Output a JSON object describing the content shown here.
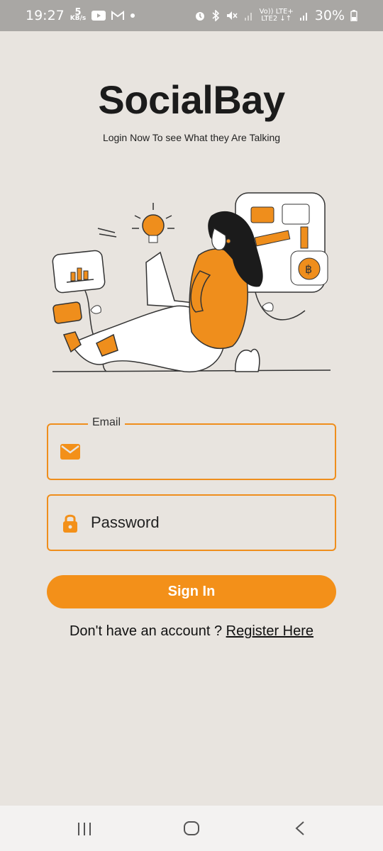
{
  "status_bar": {
    "time": "19:27",
    "speed_value": "5",
    "speed_unit": "KB/s",
    "lte_top": "Vo)) LTE+",
    "lte_bottom": "LTE2 ↓↑",
    "battery": "30%",
    "icons": [
      "youtube-icon",
      "gmail-icon",
      "dot-icon",
      "alarm-icon",
      "bluetooth-icon",
      "mute-icon",
      "signal-icon",
      "signal-icon",
      "battery-icon"
    ]
  },
  "app": {
    "title": "SocialBay",
    "subtitle": "Login Now To see What they Are Talking",
    "accent_color": "#f39019"
  },
  "form": {
    "email": {
      "label": "Email",
      "value": "",
      "placeholder": "",
      "icon": "mail-icon"
    },
    "password": {
      "label": "",
      "value": "",
      "placeholder": "Password",
      "icon": "lock-icon"
    },
    "signin_label": "Sign In"
  },
  "register": {
    "prompt": "Don't have an account ? ",
    "link_label": "Register Here"
  },
  "nav_bar": {
    "icons": [
      "recents-icon",
      "home-icon",
      "back-icon"
    ]
  }
}
